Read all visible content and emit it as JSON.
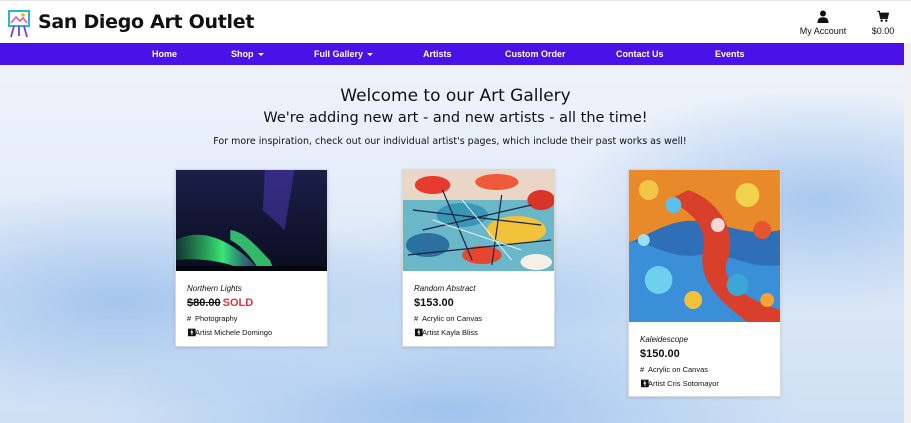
{
  "header": {
    "brand": "San Diego Art Outlet",
    "logo_icon": "easel-icon",
    "account_label": "My Account",
    "cart_total": "$0.00"
  },
  "nav": {
    "items": [
      {
        "label": "Home",
        "dropdown": false
      },
      {
        "label": "Shop",
        "dropdown": true
      },
      {
        "label": "Full Gallery",
        "dropdown": true
      },
      {
        "label": "Artists",
        "dropdown": false
      },
      {
        "label": "Custom Order",
        "dropdown": false
      },
      {
        "label": "Contact Us",
        "dropdown": false
      },
      {
        "label": "Events",
        "dropdown": false
      }
    ]
  },
  "hero": {
    "title": "Welcome to our Art Gallery",
    "subtitle": "We're adding new art - and new artists - all the time!",
    "info": "For more inspiration, check out our individual artist's pages, which include their past works as well!"
  },
  "products": [
    {
      "title": "Northern Lights",
      "price": "$80.00",
      "status": "SOLD",
      "category": "Photography",
      "artist": "Artist Michele Domingo"
    },
    {
      "title": "Random Abstract",
      "price": "$153.00",
      "status": "",
      "category": "Acrylic on Canvas",
      "artist": "Artist Kayla Bliss"
    },
    {
      "title": "Kaleidescope",
      "price": "$150.00",
      "status": "",
      "category": "Acrylic on Canvas",
      "artist": "Artist Cris Sotomayor"
    }
  ],
  "colors": {
    "nav_bg": "#4a12e6",
    "sold": "#d9344a"
  }
}
